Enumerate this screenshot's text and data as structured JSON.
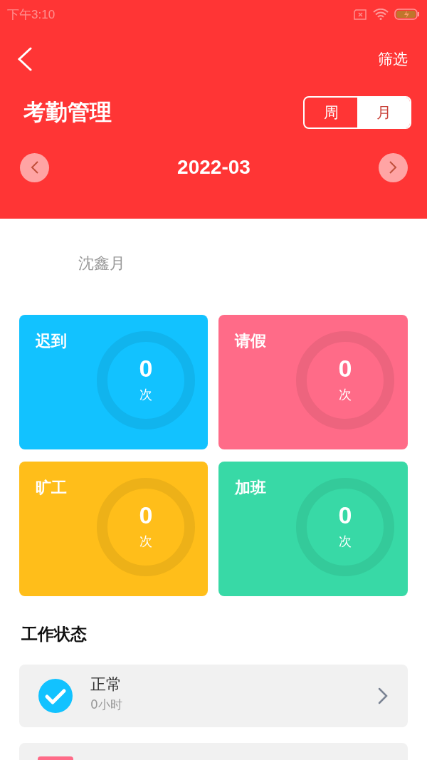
{
  "status_bar": {
    "time": "下午3:10"
  },
  "nav": {
    "filter": "筛选"
  },
  "title": "考勤管理",
  "period_tabs": [
    {
      "label": "周",
      "selected": false
    },
    {
      "label": "月",
      "selected": true
    }
  ],
  "month": "2022-03",
  "employee": "沈鑫月",
  "stats": [
    {
      "label": "迟到",
      "value": "0",
      "unit": "次",
      "color": "#12c2ff"
    },
    {
      "label": "请假",
      "value": "0",
      "unit": "次",
      "color": "#ff6b88"
    },
    {
      "label": "旷工",
      "value": "0",
      "unit": "次",
      "color": "#ffbe1a"
    },
    {
      "label": "加班",
      "value": "0",
      "unit": "次",
      "color": "#38d9a6"
    }
  ],
  "work_status": {
    "heading": "工作状态",
    "items": [
      {
        "kind": "check",
        "title": "正常",
        "detail": "0小时",
        "color": "#12c2ff",
        "chevron": true
      },
      {
        "kind": "square",
        "color": "#ff6b88"
      }
    ]
  }
}
